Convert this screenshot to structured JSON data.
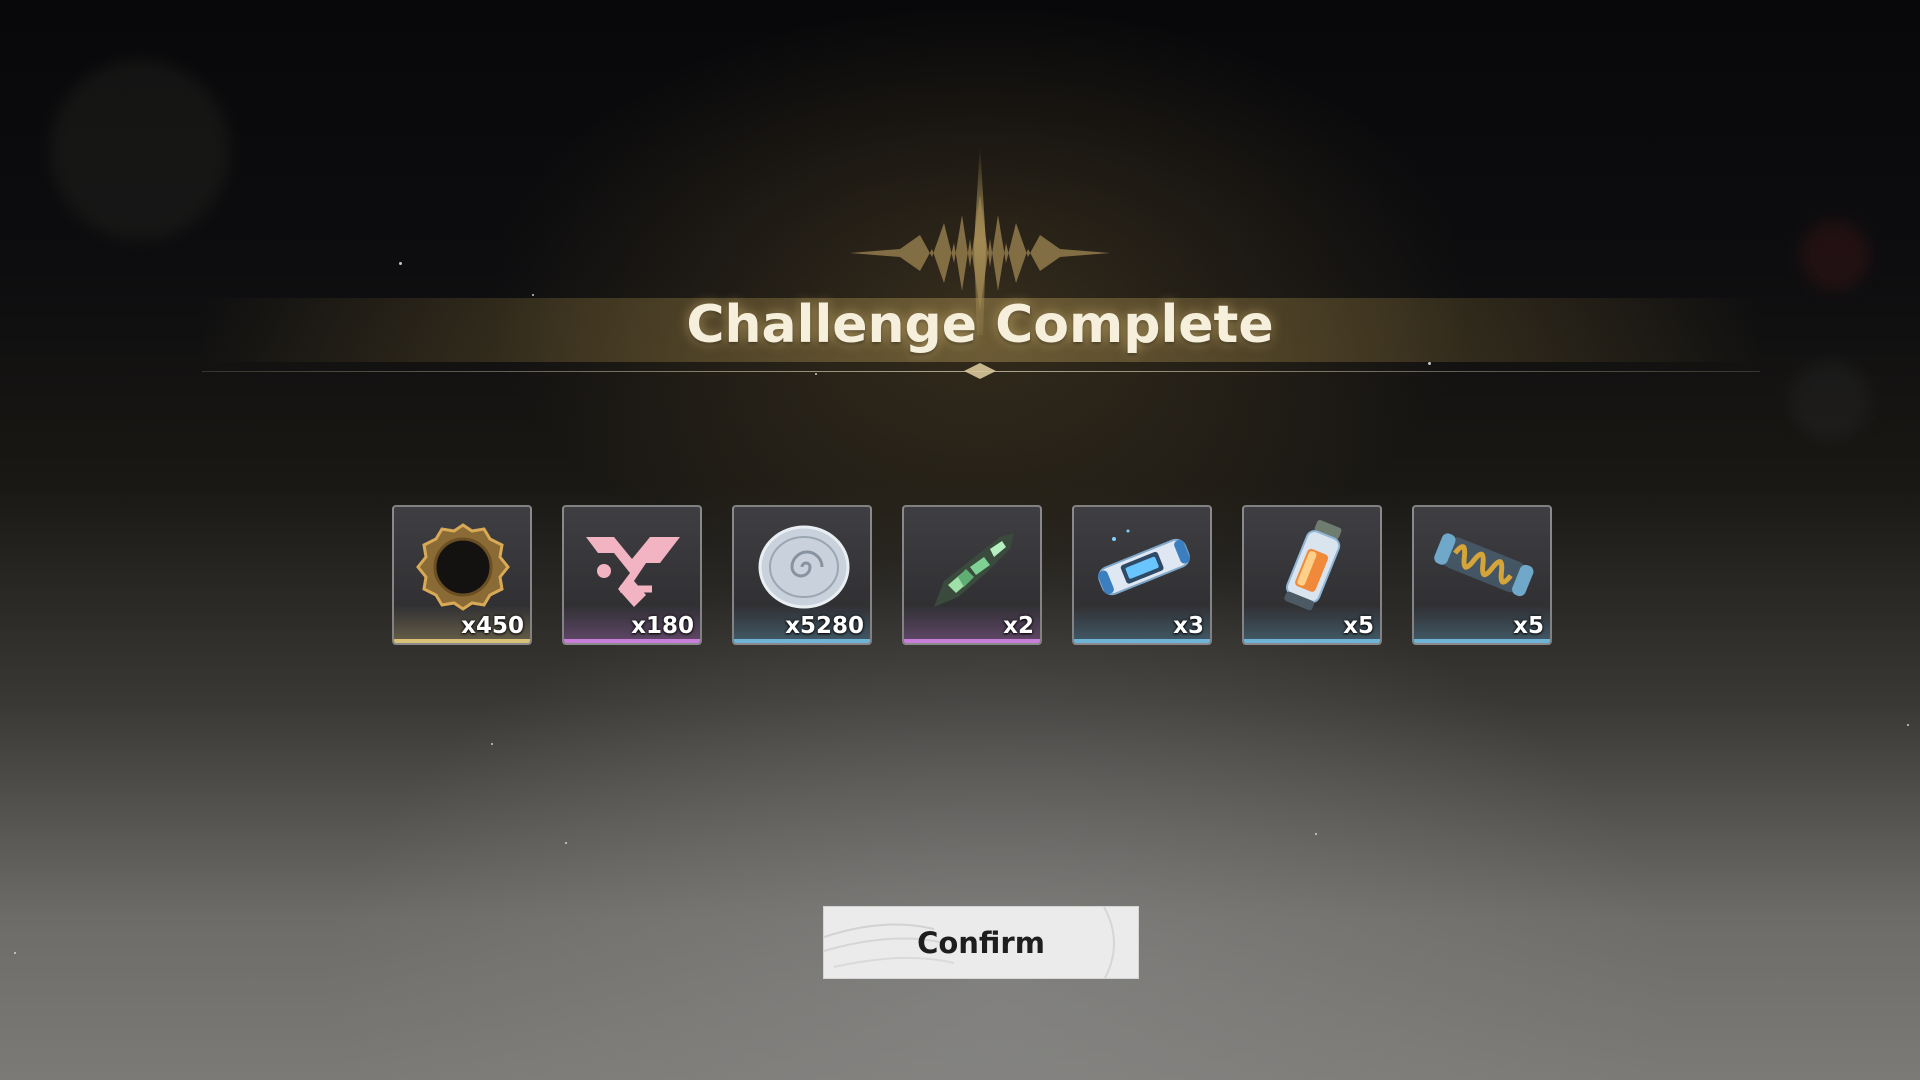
{
  "screen": {
    "title": "Challenge Complete"
  },
  "rewards": [
    {
      "icon": "dark-ring-icon",
      "quantity": "x450",
      "rarity_color": "#d8c27a"
    },
    {
      "icon": "pink-emblem-icon",
      "quantity": "x180",
      "rarity_color": "#c77fd9"
    },
    {
      "icon": "silver-shell-coin-icon",
      "quantity": "x5280",
      "rarity_color": "#6fb4d6"
    },
    {
      "icon": "green-crystal-blade-icon",
      "quantity": "x2",
      "rarity_color": "#c77fd9"
    },
    {
      "icon": "blue-energy-capsule-icon",
      "quantity": "x3",
      "rarity_color": "#6fb4d6"
    },
    {
      "icon": "orange-vial-icon",
      "quantity": "x5",
      "rarity_color": "#6fb4d6"
    },
    {
      "icon": "gold-coil-capsule-icon",
      "quantity": "x5",
      "rarity_color": "#6fb4d6"
    }
  ],
  "confirm": {
    "label": "Confirm"
  }
}
